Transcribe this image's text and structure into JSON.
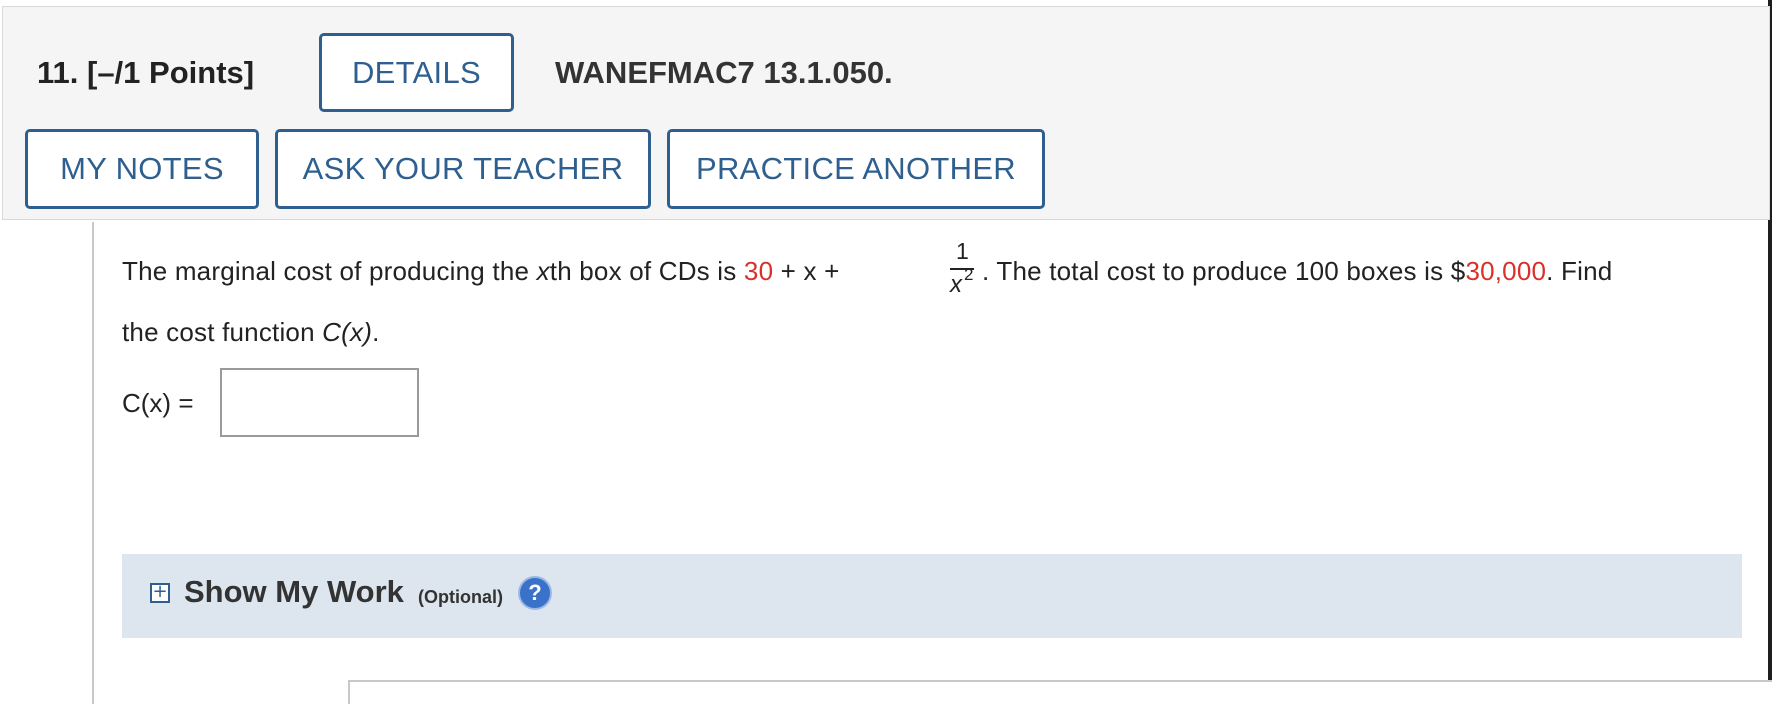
{
  "header": {
    "question_number": "11. [–/1 Points]",
    "details_label": "DETAILS",
    "question_code": "WANEFMAC7 13.1.050.",
    "my_notes_label": "MY NOTES",
    "ask_teacher_label": "ASK YOUR TEACHER",
    "practice_another_label": "PRACTICE ANOTHER"
  },
  "question": {
    "text_part1": "The marginal cost of producing the ",
    "var_x": "x",
    "text_part2": "th box of CDs is ",
    "value_30": "30",
    "plus_x": " + x + ",
    "frac_numerator": "1",
    "frac_denominator": "x",
    "frac_exponent": "2",
    "text_part3": ". The total cost to produce 100 boxes is $",
    "value_total": "30,000",
    "text_part4": ". Find",
    "line2_text": "the cost function ",
    "line2_func": "C(x)",
    "line2_end": ".",
    "answer_label": "C(x)  =",
    "answer_value": ""
  },
  "show_my_work": {
    "title": "Show My Work",
    "optional": "(Optional)",
    "help": "?"
  },
  "colors": {
    "accent": "#2e5f8f",
    "highlight_red": "#d9302b",
    "work_panel_bg": "#dde6ee"
  }
}
